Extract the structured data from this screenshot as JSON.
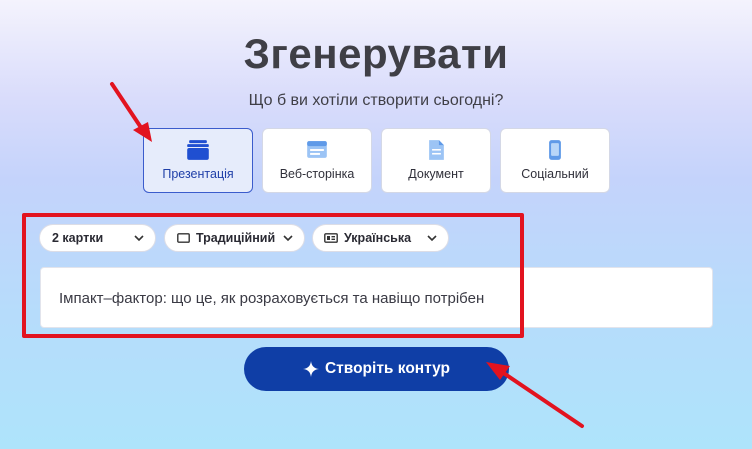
{
  "header": {
    "title": "Згенерувати",
    "subtitle": "Що б ви хотіли створити сьогодні?"
  },
  "content_types": [
    {
      "label": "Презентація",
      "icon": "presentation-icon",
      "selected": true
    },
    {
      "label": "Веб-сторінка",
      "icon": "webpage-icon",
      "selected": false
    },
    {
      "label": "Документ",
      "icon": "document-icon",
      "selected": false
    },
    {
      "label": "Соціальний",
      "icon": "social-phone-icon",
      "selected": false
    }
  ],
  "options": {
    "cards": "2 картки",
    "format": "Традиційний",
    "language": "Українська"
  },
  "prompt": {
    "value": "Імпакт–фактор: що це, як розраховується та навіщо потрібен"
  },
  "cta": {
    "label": "Створіть контур"
  },
  "colors": {
    "accent": "#0f3ea6",
    "annotation_red": "#e2131f",
    "selected_card_bg": "#e6ecfb"
  }
}
